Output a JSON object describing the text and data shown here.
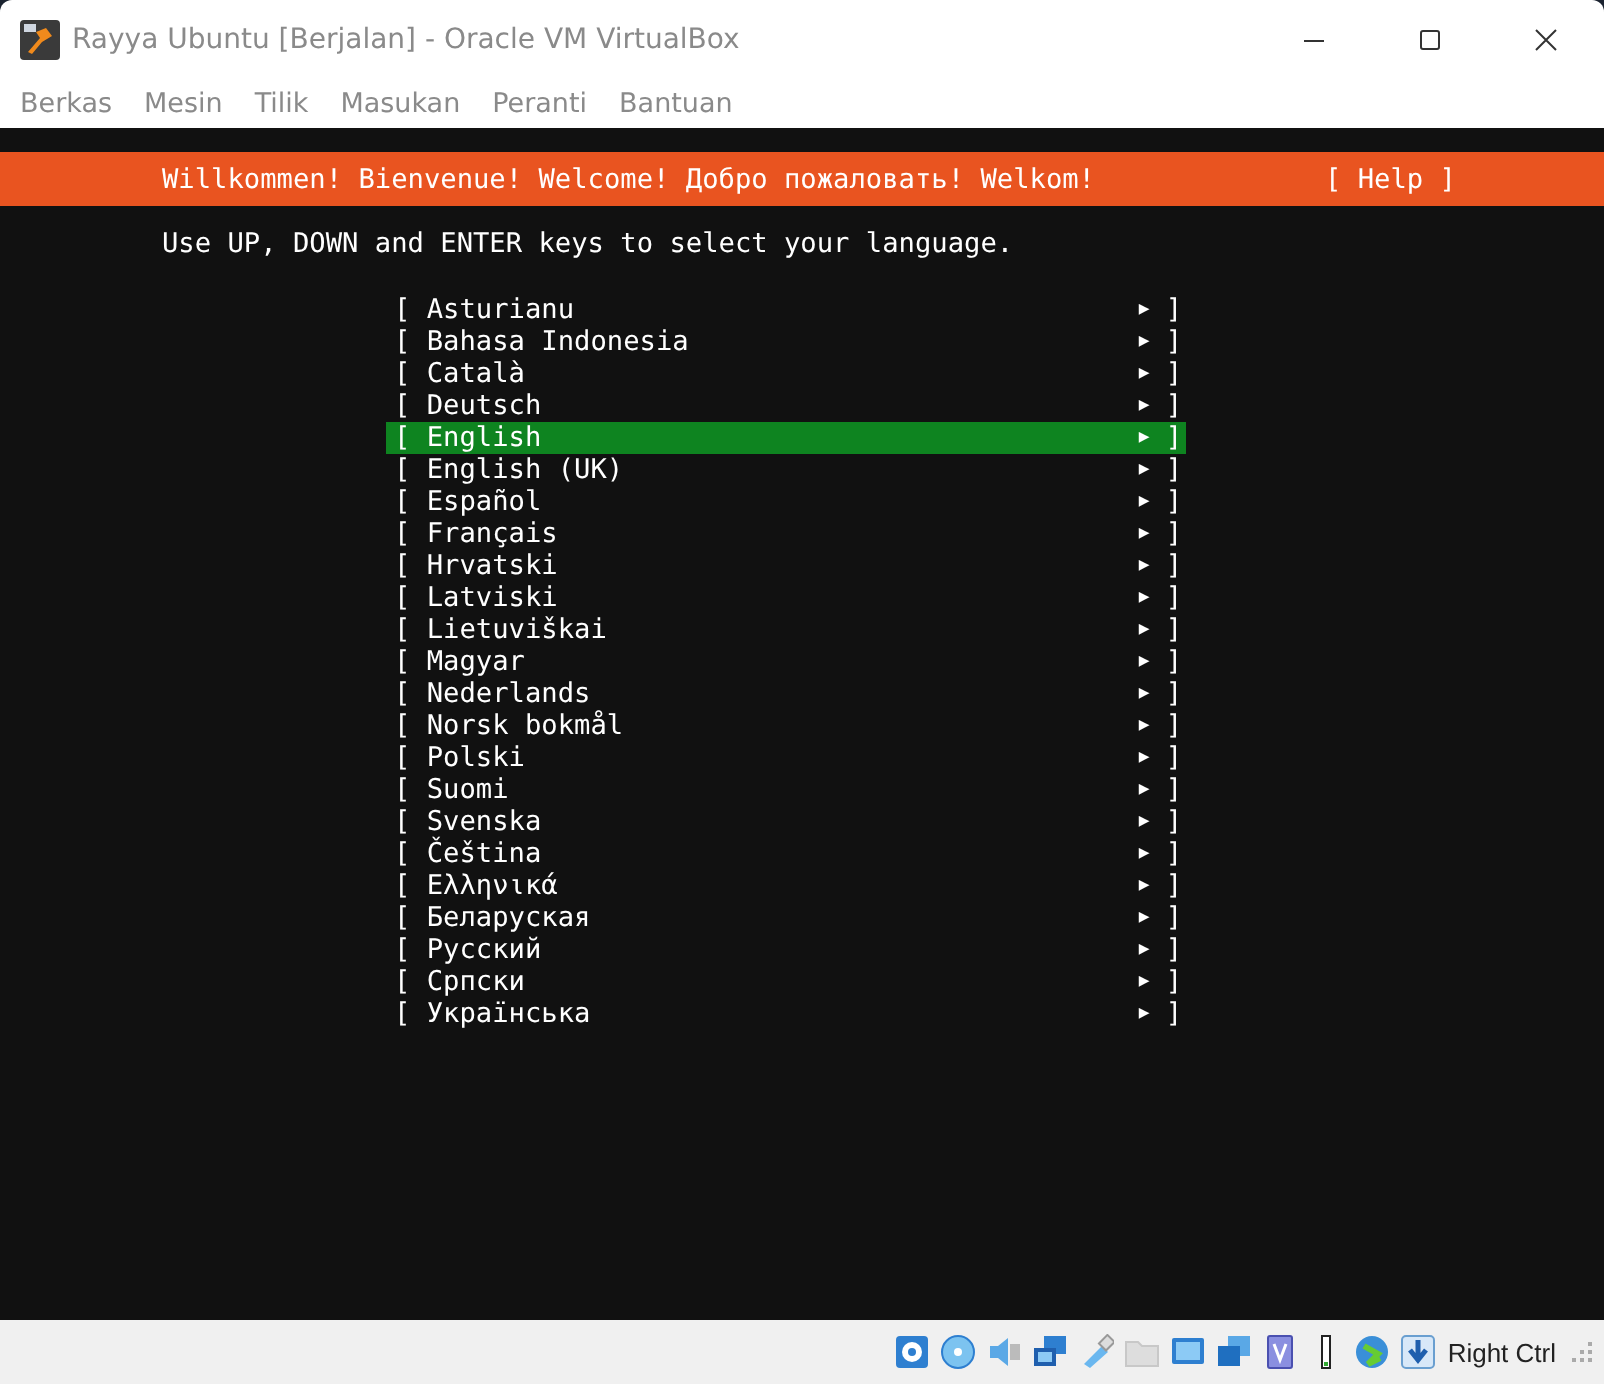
{
  "window": {
    "title": "Rayya Ubuntu [Berjalan] - Oracle VM VirtualBox"
  },
  "menu": [
    "Berkas",
    "Mesin",
    "Tilik",
    "Masukan",
    "Peranti",
    "Bantuan"
  ],
  "installer": {
    "banner": "Willkommen! Bienvenue! Welcome! Добро пожаловать! Welkom!",
    "help": "[ Help ]",
    "instruction": "Use UP, DOWN and ENTER keys to select your language.",
    "languages": [
      {
        "open": "[",
        "label": "Asturianu",
        "arrow": "▶",
        "close": "]",
        "selected": false
      },
      {
        "open": "[",
        "label": "Bahasa Indonesia",
        "arrow": "▶",
        "close": "]",
        "selected": false
      },
      {
        "open": "[",
        "label": "Català",
        "arrow": "▶",
        "close": "]",
        "selected": false
      },
      {
        "open": "[",
        "label": "Deutsch",
        "arrow": "▶",
        "close": "]",
        "selected": false
      },
      {
        "open": "[",
        "label": "English",
        "arrow": "▶",
        "close": "]",
        "selected": true
      },
      {
        "open": "[",
        "label": "English (UK)",
        "arrow": "▶",
        "close": "]",
        "selected": false
      },
      {
        "open": "[",
        "label": "Español",
        "arrow": "▶",
        "close": "]",
        "selected": false
      },
      {
        "open": "[",
        "label": "Français",
        "arrow": "▶",
        "close": "]",
        "selected": false
      },
      {
        "open": "[",
        "label": "Hrvatski",
        "arrow": "▶",
        "close": "]",
        "selected": false
      },
      {
        "open": "[",
        "label": "Latviski",
        "arrow": "▶",
        "close": "]",
        "selected": false
      },
      {
        "open": "[",
        "label": "Lietuviškai",
        "arrow": "▶",
        "close": "]",
        "selected": false
      },
      {
        "open": "[",
        "label": "Magyar",
        "arrow": "▶",
        "close": "]",
        "selected": false
      },
      {
        "open": "[",
        "label": "Nederlands",
        "arrow": "▶",
        "close": "]",
        "selected": false
      },
      {
        "open": "[",
        "label": "Norsk bokmål",
        "arrow": "▶",
        "close": "]",
        "selected": false
      },
      {
        "open": "[",
        "label": "Polski",
        "arrow": "▶",
        "close": "]",
        "selected": false
      },
      {
        "open": "[",
        "label": "Suomi",
        "arrow": "▶",
        "close": "]",
        "selected": false
      },
      {
        "open": "[",
        "label": "Svenska",
        "arrow": "▶",
        "close": "]",
        "selected": false
      },
      {
        "open": "[",
        "label": "Čeština",
        "arrow": "▶",
        "close": "]",
        "selected": false
      },
      {
        "open": "[",
        "label": "Ελληνικά",
        "arrow": "▶",
        "close": "]",
        "selected": false
      },
      {
        "open": "[",
        "label": "Беларуская",
        "arrow": "▶",
        "close": "]",
        "selected": false
      },
      {
        "open": "[",
        "label": "Русский",
        "arrow": "▶",
        "close": "]",
        "selected": false
      },
      {
        "open": "[",
        "label": "Српски",
        "arrow": "▶",
        "close": "]",
        "selected": false
      },
      {
        "open": "[",
        "label": "Українська",
        "arrow": "▶",
        "close": "]",
        "selected": false
      }
    ]
  },
  "status_bar": {
    "host_key": "Right Ctrl"
  }
}
